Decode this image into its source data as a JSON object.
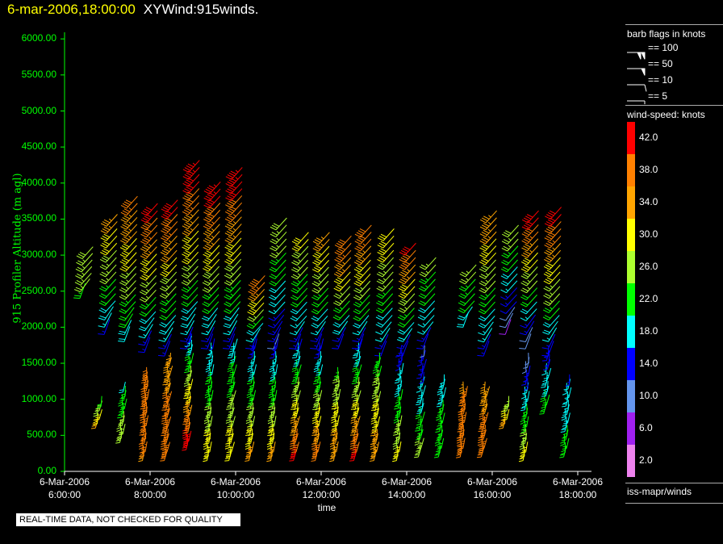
{
  "title": {
    "datetime": "6-mar-2006,18:00:00",
    "product": "XYWind:915winds."
  },
  "quality_note": "REAL-TIME DATA, NOT CHECKED FOR QUALITY",
  "legend": {
    "barb_title": "barb flags in knots",
    "barbs": [
      {
        "label": "== 100",
        "value": 100
      },
      {
        "label": "== 50",
        "value": 50
      },
      {
        "label": "== 10",
        "value": 10
      },
      {
        "label": "== 5",
        "value": 5
      }
    ],
    "colorbar_title": "wind-speed: knots",
    "colorbar": [
      {
        "label": "42.0",
        "color": "#ff0000"
      },
      {
        "label": "38.0",
        "color": "#ff8000"
      },
      {
        "label": "34.0",
        "color": "#ffa500"
      },
      {
        "label": "30.0",
        "color": "#ffff00"
      },
      {
        "label": "26.0",
        "color": "#adff2f"
      },
      {
        "label": "22.0",
        "color": "#00ff00"
      },
      {
        "label": "18.0",
        "color": "#00ffff"
      },
      {
        "label": "14.0",
        "color": "#0000ff"
      },
      {
        "label": "10.0",
        "color": "#6495ed"
      },
      {
        "label": "6.0",
        "color": "#a020f0"
      },
      {
        "label": "2.0",
        "color": "#ee82ee"
      }
    ],
    "source": "iss-mapr/winds"
  },
  "chart_data": {
    "type": "scatter",
    "subtype": "wind-barb time-height",
    "xlabel": "time",
    "ylabel": "915 Profiler Altitude (m agl)",
    "xlim_hours": [
      6,
      18.3
    ],
    "ylim": [
      0,
      6000
    ],
    "yticks": [
      "0.00",
      "500.00",
      "1000.00",
      "1500.00",
      "2000.00",
      "2500.00",
      "3000.00",
      "3500.00",
      "4000.00",
      "4500.00",
      "5000.00",
      "5500.00",
      "6000.00"
    ],
    "xticks": [
      {
        "date": "6-Mar-2006",
        "time": "6:00:00"
      },
      {
        "date": "6-Mar-2006",
        "time": "8:00:00"
      },
      {
        "date": "6-Mar-2006",
        "time": "10:00:00"
      },
      {
        "date": "6-Mar-2006",
        "time": "12:00:00"
      },
      {
        "date": "6-Mar-2006",
        "time": "14:00:00"
      },
      {
        "date": "6-Mar-2006",
        "time": "16:00:00"
      },
      {
        "date": "6-Mar-2006",
        "time": "18:00:00"
      }
    ],
    "profiles_upper": [
      [
        6.47,
        2400,
        2950,
        24,
        28
      ],
      [
        7.04,
        1900,
        3400,
        16,
        34
      ],
      [
        7.51,
        1800,
        3650,
        18,
        38
      ],
      [
        7.98,
        1650,
        3550,
        14,
        42
      ],
      [
        8.45,
        1600,
        3600,
        14,
        42
      ],
      [
        8.96,
        1700,
        4150,
        14,
        44
      ],
      [
        9.45,
        1700,
        3850,
        14,
        44
      ],
      [
        9.96,
        1700,
        4050,
        14,
        44
      ],
      [
        10.49,
        1700,
        2550,
        14,
        40
      ],
      [
        11.0,
        1700,
        3350,
        12,
        28
      ],
      [
        11.51,
        1700,
        3150,
        14,
        30
      ],
      [
        12.0,
        1700,
        3150,
        14,
        34
      ],
      [
        12.51,
        1700,
        3100,
        14,
        40
      ],
      [
        12.98,
        1700,
        3250,
        14,
        40
      ],
      [
        13.51,
        1600,
        3200,
        14,
        32
      ],
      [
        14.02,
        1600,
        3000,
        14,
        42
      ],
      [
        14.49,
        1700,
        2800,
        14,
        26
      ],
      [
        15.43,
        2000,
        2700,
        18,
        26
      ],
      [
        15.91,
        1600,
        3450,
        14,
        36
      ],
      [
        16.42,
        1900,
        3250,
        8,
        28
      ],
      [
        16.89,
        1700,
        3450,
        10,
        42
      ],
      [
        17.42,
        1600,
        3500,
        14,
        42
      ]
    ],
    "profiles_lower": [
      [
        6.75,
        600,
        900,
        34,
        22
      ],
      [
        7.32,
        400,
        1100,
        28,
        20
      ],
      [
        7.85,
        150,
        1300,
        36,
        40
      ],
      [
        8.36,
        150,
        1500,
        40,
        34
      ],
      [
        8.87,
        300,
        1800,
        44,
        16
      ],
      [
        9.36,
        150,
        1700,
        32,
        16
      ],
      [
        9.87,
        150,
        1700,
        32,
        18
      ],
      [
        10.34,
        150,
        1700,
        34,
        14
      ],
      [
        10.85,
        150,
        1700,
        34,
        14
      ],
      [
        11.38,
        150,
        1700,
        42,
        16
      ],
      [
        11.89,
        150,
        1700,
        40,
        14
      ],
      [
        12.32,
        150,
        1300,
        36,
        24
      ],
      [
        12.79,
        150,
        1700,
        42,
        16
      ],
      [
        13.26,
        150,
        1500,
        36,
        22
      ],
      [
        13.79,
        150,
        1600,
        30,
        14
      ],
      [
        14.3,
        200,
        1600,
        26,
        12
      ],
      [
        14.77,
        200,
        1200,
        24,
        18
      ],
      [
        15.28,
        200,
        1100,
        40,
        36
      ],
      [
        15.77,
        200,
        1100,
        40,
        34
      ],
      [
        16.28,
        600,
        900,
        34,
        26
      ],
      [
        16.75,
        150,
        1500,
        30,
        10
      ],
      [
        17.23,
        800,
        1600,
        22,
        14
      ],
      [
        17.7,
        200,
        1200,
        22,
        16
      ]
    ],
    "profile_fields": [
      "time_hours",
      "bottom_m",
      "top_m",
      "speed_bottom_kt",
      "speed_top_kt"
    ]
  }
}
